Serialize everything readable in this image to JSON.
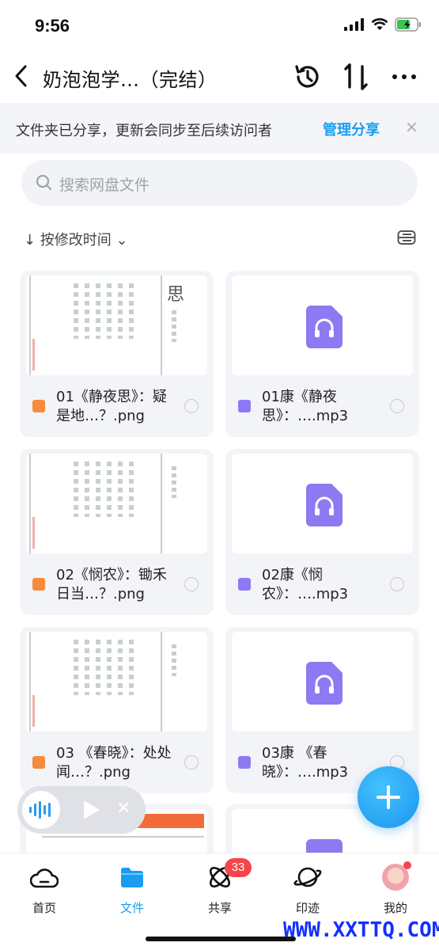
{
  "status": {
    "time": "9:56"
  },
  "nav": {
    "title": "奶泡泡学…（完结）"
  },
  "banner": {
    "text": "文件夹已分享，更新会同步至后续访问者",
    "manage": "管理分享",
    "close": "×"
  },
  "search": {
    "placeholder": "搜索网盘文件"
  },
  "sort": {
    "label": "↓ 按修改时间 ⌄"
  },
  "files": [
    {
      "name": "01《静夜思》：疑是地…？.png",
      "type": "image"
    },
    {
      "name": "01康《静夜思》：….mp3",
      "type": "audio"
    },
    {
      "name": "02《悯农》：锄禾日当…？.png",
      "type": "image"
    },
    {
      "name": "02康《悯农》：….mp3",
      "type": "audio"
    },
    {
      "name": "03 《春晓》：处处闻…？.png",
      "type": "image"
    },
    {
      "name": "03康 《春晓》：….mp3",
      "type": "audio"
    }
  ],
  "thumbs": {
    "title1": "思"
  },
  "tabs": [
    {
      "label": "首页"
    },
    {
      "label": "文件"
    },
    {
      "label": "共享",
      "badge": "33"
    },
    {
      "label": "印迹"
    },
    {
      "label": "我的"
    }
  ],
  "watermark": "WWW.XXTTQ.COM",
  "colors": {
    "accent": "#1a9df0",
    "audio": "#8d7af2",
    "image": "#f58b3c",
    "badge": "#f5454b"
  }
}
